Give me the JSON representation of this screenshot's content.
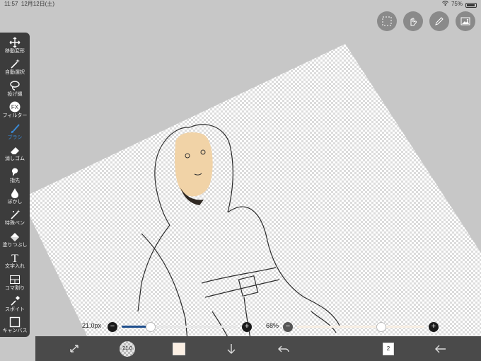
{
  "status": {
    "time": "11:57",
    "date": "12月12日(土)",
    "battery": "75%",
    "battery_level": 0.75
  },
  "left_toolbar": {
    "tools": [
      {
        "label": "移動変形",
        "icon": "move-icon"
      },
      {
        "label": "自動選択",
        "icon": "magic-wand-icon"
      },
      {
        "label": "投げ縄",
        "icon": "lasso-icon"
      },
      {
        "label": "フィルター",
        "icon": "fx-icon",
        "icon_text": "FX"
      },
      {
        "label": "ブラシ",
        "icon": "brush-icon",
        "active": true
      },
      {
        "label": "消しゴム",
        "icon": "eraser-icon"
      },
      {
        "label": "指先",
        "icon": "smudge-icon"
      },
      {
        "label": "ぼかし",
        "icon": "blur-drop-icon"
      },
      {
        "label": "特殊ペン",
        "icon": "special-pen-icon"
      },
      {
        "label": "塗りつぶし",
        "icon": "bucket-icon"
      },
      {
        "label": "文字入れ",
        "icon": "text-icon",
        "icon_text": "T"
      },
      {
        "label": "コマ割り",
        "icon": "panel-divide-icon"
      },
      {
        "label": "スポイト",
        "icon": "eyedropper-icon"
      },
      {
        "label": "キャンバス",
        "icon": "canvas-icon"
      }
    ]
  },
  "top_tools": [
    "selection-icon",
    "hand-icon",
    "pen-icon",
    "image-icon"
  ],
  "sliders": {
    "size_label": "21.0px",
    "size_value": 0.24,
    "opacity_label": "68%",
    "opacity_value": 0.68,
    "minus": "−",
    "plus": "+"
  },
  "bottombar": {
    "brush_size": "21.0",
    "current_color": "#fbefe3",
    "layer_count": "2"
  },
  "colors": {
    "accent": "#3a8bd8",
    "toolbar_bg": "#3c3c3c",
    "bottombar_bg": "#4a4a4a",
    "background": "#c7c7c7"
  }
}
